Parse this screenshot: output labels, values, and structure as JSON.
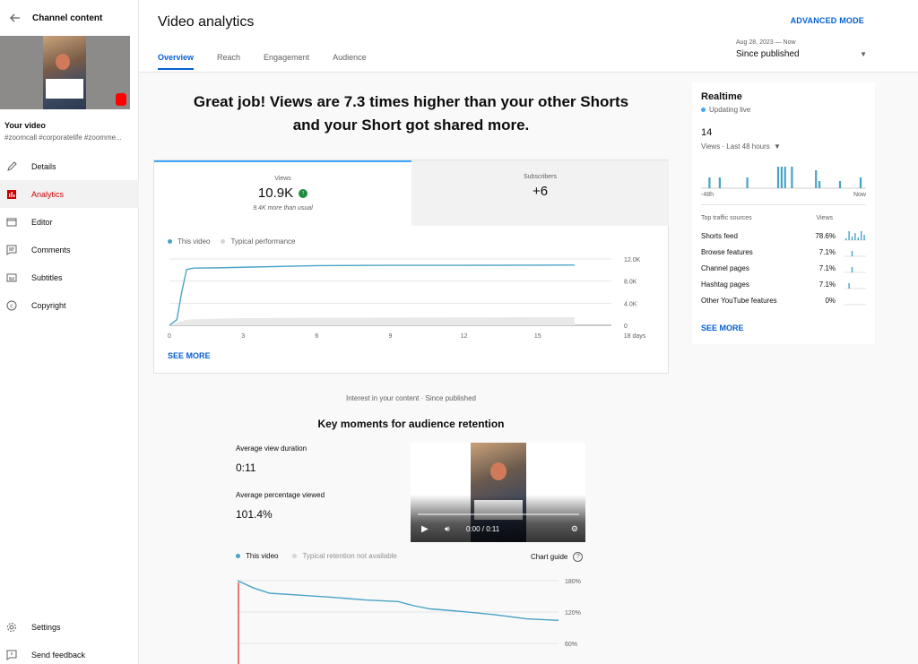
{
  "colors": {
    "accent_blue": "#065fd4",
    "chart_teal": "#3ea6ff",
    "series_line": "#4aa3c6",
    "active_red": "#cc0000",
    "up_green": "#1e8e3e",
    "bar_color": "#4aa3c6"
  },
  "sidebar": {
    "back_icon": "arrow-left-icon",
    "title": "Channel content",
    "your_video": "Your video",
    "tags": "#zoomcall #corporatelife #zoomme...",
    "items": [
      {
        "label": "Details",
        "icon": "pencil-icon"
      },
      {
        "label": "Analytics",
        "icon": "analytics-icon",
        "active": true
      },
      {
        "label": "Editor",
        "icon": "editor-icon"
      },
      {
        "label": "Comments",
        "icon": "comments-icon"
      },
      {
        "label": "Subtitles",
        "icon": "subtitles-icon"
      },
      {
        "label": "Copyright",
        "icon": "copyright-icon"
      }
    ],
    "bottom": [
      {
        "label": "Settings",
        "icon": "gear-icon"
      },
      {
        "label": "Send feedback",
        "icon": "feedback-icon"
      }
    ]
  },
  "header": {
    "title": "Video analytics",
    "advanced_mode": "ADVANCED MODE",
    "tabs": [
      "Overview",
      "Reach",
      "Engagement",
      "Audience"
    ],
    "date_range": "Aug 28, 2023 — Now",
    "date_label": "Since published"
  },
  "headline": {
    "line1": "Great job! Views are 7.3 times higher than your other Shorts",
    "line2": "and your Short got shared more."
  },
  "views_card": {
    "views_label": "Views",
    "views_value": "10.9K",
    "views_note": "9.4K more than usual",
    "subs_label": "Subscribers",
    "subs_value": "+6",
    "legend_this": "This video",
    "legend_typical": "Typical performance",
    "see_more": "SEE MORE"
  },
  "chart_data": [
    {
      "type": "line",
      "x": [
        0,
        0.3,
        0.5,
        0.7,
        1,
        2,
        3,
        6,
        9,
        12,
        15,
        16.5
      ],
      "series": [
        {
          "name": "This video",
          "values": [
            0,
            1000,
            6000,
            10100,
            10350,
            10400,
            10500,
            10800,
            10850,
            10850,
            10880,
            10900
          ]
        },
        {
          "name": "Typical performance",
          "values": [
            0,
            500,
            800,
            1000,
            1100,
            1200,
            1300,
            1350,
            1400,
            1420,
            1450,
            1460
          ]
        }
      ],
      "xticks": [
        "0",
        "3",
        "6",
        "9",
        "12",
        "15",
        "18 days"
      ],
      "yticks": [
        "12.0K",
        "8.0K",
        "4.0K",
        "0"
      ],
      "xlim": [
        0,
        18
      ],
      "ylim": [
        0,
        12000
      ],
      "legend": "top-left"
    },
    {
      "type": "line",
      "x": [
        0,
        5,
        10,
        20,
        30,
        40,
        50,
        55,
        60,
        70,
        80,
        90,
        100
      ],
      "series": [
        {
          "name": "This video",
          "values": [
            180,
            166,
            156,
            152,
            148,
            143,
            140,
            132,
            126,
            121,
            115,
            107,
            104
          ]
        }
      ],
      "yticks": [
        "180%",
        "120%",
        "60%"
      ],
      "ylim": [
        40,
        180
      ]
    }
  ],
  "retention": {
    "interest": "Interest in your content · Since published",
    "title": "Key moments for audience retention",
    "avg_duration_label": "Average view duration",
    "avg_duration_value": "0:11",
    "avg_pct_label": "Average percentage viewed",
    "avg_pct_value": "101.4%",
    "player_time": "0:00 / 0:11",
    "legend_this": "This video",
    "legend_typical": "Typical retention not available",
    "chart_guide": "Chart guide"
  },
  "realtime": {
    "title": "Realtime",
    "live": "Updating live",
    "count": "14",
    "period": "Views · Last 48 hours",
    "axis_left": "-48h",
    "axis_right": "Now",
    "bars": [
      0,
      0,
      3,
      0,
      0,
      3,
      0,
      0,
      0,
      0,
      0,
      0,
      0,
      3,
      0,
      0,
      0,
      0,
      0,
      0,
      0,
      0,
      6,
      6,
      6,
      0,
      6,
      0,
      0,
      0,
      0,
      0,
      0,
      5,
      2,
      0,
      0,
      0,
      0,
      0,
      2,
      0,
      0,
      0,
      0,
      0,
      3,
      0
    ],
    "sources_header": "Top traffic sources",
    "views_header": "Views",
    "sources": [
      {
        "name": "Shorts feed",
        "pct": "78.6%"
      },
      {
        "name": "Browse features",
        "pct": "7.1%"
      },
      {
        "name": "Channel pages",
        "pct": "7.1%"
      },
      {
        "name": "Hashtag pages",
        "pct": "7.1%"
      },
      {
        "name": "Other YouTube features",
        "pct": "0%"
      }
    ],
    "see_more": "SEE MORE"
  }
}
